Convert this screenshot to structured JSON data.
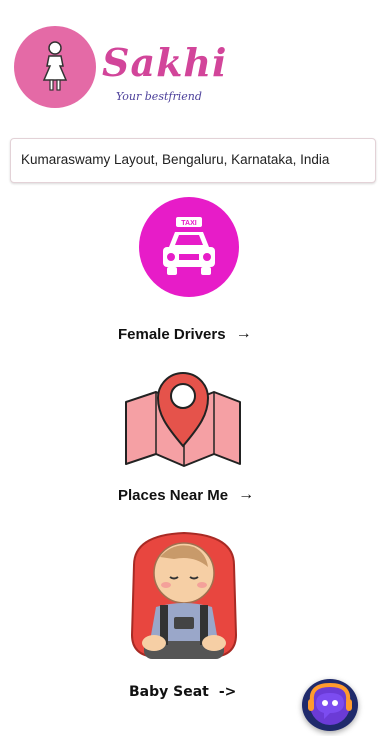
{
  "brand": {
    "name": "Sakhi",
    "tagline": "Your bestfriend"
  },
  "location": {
    "text": "Kumaraswamy Layout, Bengaluru, Karnataka, India"
  },
  "features": [
    {
      "label": "Female Drivers",
      "arrow": "→",
      "icon": "taxi-icon",
      "sign": "TAXI"
    },
    {
      "label": "Places Near Me",
      "arrow": "→",
      "icon": "map-pin-icon"
    },
    {
      "label": "Baby Seat",
      "arrow": "->",
      "icon": "baby-seat-icon"
    }
  ],
  "chat": {
    "icon": "chatbot-icon"
  },
  "colors": {
    "brand_pink": "#d2459a",
    "taxi_magenta": "#e71cc8",
    "map_red": "#e5534b"
  }
}
